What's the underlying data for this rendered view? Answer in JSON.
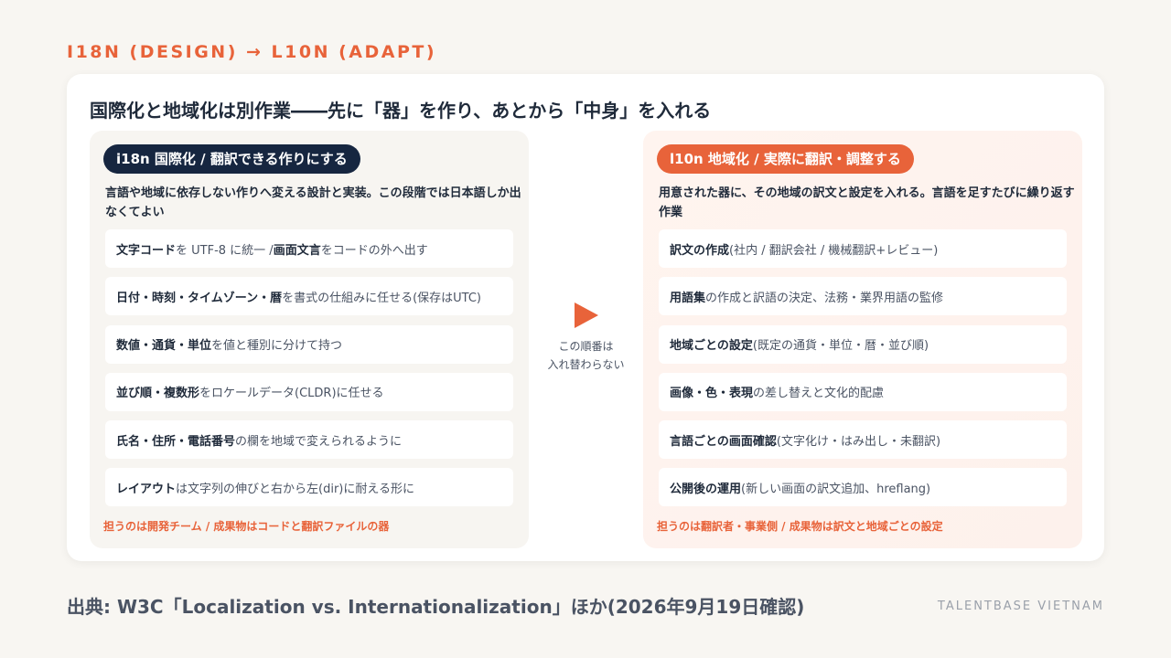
{
  "kicker": "I18N (DESIGN) → L10N (ADAPT)",
  "title": "国際化と地域化は別作業――先に「器」を作り、あとから「中身」を入れる",
  "left": {
    "badge": "i18n 国際化 / 翻訳できる作りにする",
    "desc": "言語や地域に依存しない作りへ変える設計と実装。この段階では日本語しか出なくてよい",
    "items": [
      {
        "bold": "文字コード",
        "text": "を UTF-8 に統一 / ",
        "bold2": "画面文言",
        "text2": "をコードの外へ出す"
      },
      {
        "bold": "日付・時刻・タイムゾーン・暦",
        "text": "を書式の仕組みに任せる(保存はUTC)"
      },
      {
        "bold": "数値・通貨・単位",
        "text": "を値と種別に分けて持つ"
      },
      {
        "bold": "並び順・複数形",
        "text": "をロケールデータ(CLDR)に任せる"
      },
      {
        "bold": "氏名・住所・電話番号",
        "text": "の欄を地域で変えられるように"
      },
      {
        "bold": "レイアウト",
        "text": "は文字列の伸びと右から左(dir)に耐える形に"
      }
    ],
    "foot": "担うのは開発チーム / 成果物はコードと翻訳ファイルの器"
  },
  "middle": {
    "arrow_icon": "play-arrow-icon",
    "line1": "この順番は",
    "line2": "入れ替わらない"
  },
  "right": {
    "badge": "l10n 地域化 / 実際に翻訳・調整する",
    "desc": "用意された器に、その地域の訳文と設定を入れる。言語を足すたびに繰り返す作業",
    "items": [
      {
        "bold": "訳文の作成",
        "text": "(社内 / 翻訳会社 / 機械翻訳+レビュー)"
      },
      {
        "bold": "用語集",
        "text": "の作成と訳語の決定、法務・業界用語の監修"
      },
      {
        "bold": "地域ごとの設定",
        "text": "(既定の通貨・単位・暦・並び順)"
      },
      {
        "bold": "画像・色・表現",
        "text": "の差し替えと文化的配慮"
      },
      {
        "bold": "言語ごとの画面確認",
        "text": "(文字化け・はみ出し・未翻訳)"
      },
      {
        "bold": "公開後の運用",
        "text": "(新しい画面の訳文追加、hreflang)"
      }
    ],
    "foot": "担うのは翻訳者・事業側 / 成果物は訳文と地域ごとの設定"
  },
  "source": "出典: W3C「Localization vs. Internationalization」ほか(2026年9月19日確認)",
  "brand": "TALENTBASE VIETNAM",
  "colors": {
    "accent": "#e8633a",
    "navy": "#162640",
    "text": "#1f2a3a"
  }
}
